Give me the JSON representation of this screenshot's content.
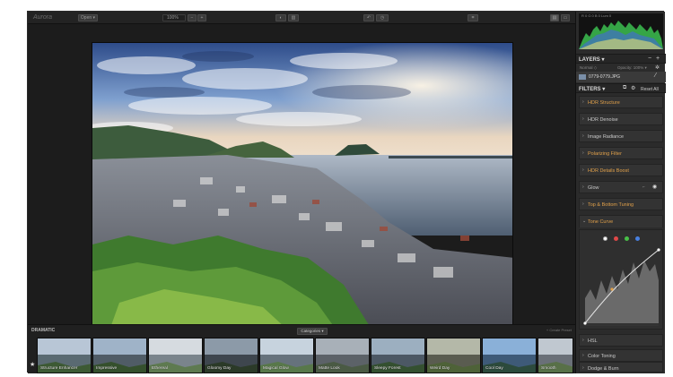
{
  "toolbar": {
    "logo": "Aurora",
    "open_label": "Open ▾",
    "zoom_value": "100%",
    "zoom_minus": "−",
    "zoom_plus": "+"
  },
  "histogram": {
    "readout": "R 0   G 0   B 0   Lum 0"
  },
  "layers": {
    "title": "LAYERS ▾",
    "add_icon": "+",
    "normal_label": "Normal ◇",
    "opacity_label": "Opacity: 100% ▾",
    "layer_name": "0779-0779.JPG"
  },
  "filters": {
    "title": "FILTERS ▾",
    "reset_label": "Reset All",
    "items": [
      "HDR Structure",
      "HDR Denoise",
      "Image Radiance",
      "Polarizing Filter",
      "HDR Details Boost",
      "Glow",
      "Top & Bottom Tuning",
      "Tone Curve",
      "HSL",
      "Color Toning",
      "Dodge & Burn"
    ],
    "active": [
      "HDR Structure",
      "Polarizing Filter",
      "HDR Details Boost",
      "Top & Bottom Tuning",
      "Tone Curve"
    ]
  },
  "presets": {
    "header": "DRAMATIC",
    "category_label": "Categories ▾",
    "right_label": "+ Create Preset",
    "items": [
      "Structure Enhancer",
      "Impressive",
      "Ethereal",
      "Gloomy Day",
      "Magical Glow",
      "Matte Look",
      "Sleepy Forest",
      "Weird Day",
      "Cool Day",
      "Smooth"
    ]
  },
  "colors": {
    "accent": "#e0a04a",
    "curve_white": "#ffffff",
    "curve_red": "#e04848",
    "curve_green": "#48c048",
    "curve_blue": "#4880e0"
  }
}
